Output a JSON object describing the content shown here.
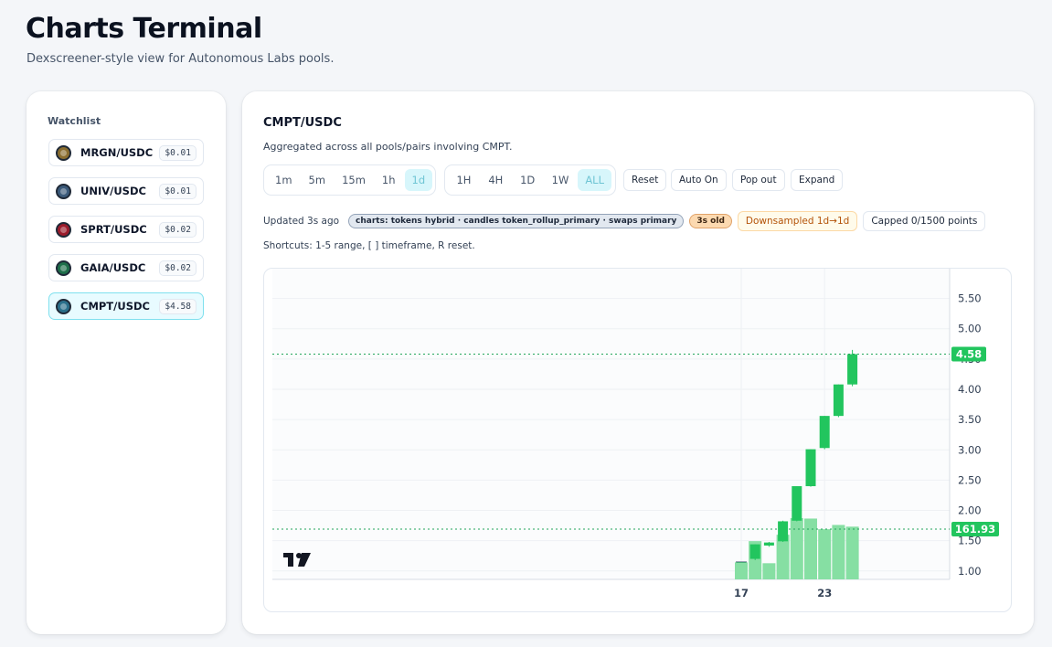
{
  "header": {
    "title": "Charts Terminal",
    "subtitle": "Dexscreener-style view for Autonomous Labs pools."
  },
  "watchlist": {
    "title": "Watchlist",
    "items": [
      {
        "label": "MRGN/USDC",
        "price": "$0.01",
        "color": "#8a6d2f",
        "icon": "mrgn-token-icon"
      },
      {
        "label": "UNIV/USDC",
        "price": "$0.01",
        "color": "#3b5a7a",
        "icon": "univ-token-icon"
      },
      {
        "label": "SPRT/USDC",
        "price": "$0.02",
        "color": "#9b1c2c",
        "icon": "sprt-token-icon"
      },
      {
        "label": "GAIA/USDC",
        "price": "$0.02",
        "color": "#1f6f4a",
        "icon": "gaia-token-icon"
      },
      {
        "label": "CMPT/USDC",
        "price": "$4.58",
        "color": "#2a6f8a",
        "icon": "cmpt-token-icon",
        "active": true
      }
    ]
  },
  "main": {
    "pair_title": "CMPT/USDC",
    "aggregate_text": "Aggregated across all pools/pairs involving CMPT.",
    "timeframes": [
      "1m",
      "5m",
      "15m",
      "1h",
      "1d"
    ],
    "active_timeframe": "1d",
    "ranges": [
      "1H",
      "4H",
      "1D",
      "1W",
      "ALL"
    ],
    "active_range": "ALL",
    "actions": {
      "reset": "Reset",
      "auto": "Auto On",
      "popout": "Pop out",
      "expand": "Expand"
    },
    "status": {
      "updated": "Updated 3s ago",
      "source_badge": "charts: tokens hybrid · candles token_rollup_primary · swaps primary",
      "age_badge": "3s old",
      "downsampled": "Downsampled 1d→1d",
      "capped": "Capped 0/1500 points"
    },
    "shortcuts": "Shortcuts: 1-5 range, [ ] timeframe, R reset."
  },
  "chart_data": {
    "type": "candlestick",
    "y_ticks": [
      "5.50",
      "5.00",
      "4.50",
      "4.00",
      "3.50",
      "3.00",
      "2.50",
      "2.00",
      "1.50",
      "1.00"
    ],
    "ylim": [
      0.65,
      5.75
    ],
    "x_ticks": [
      {
        "label": "17",
        "day": 17
      },
      {
        "label": "23",
        "day": 23
      }
    ],
    "last_price_label": "4.58",
    "volume_label": "161.93",
    "up_color": "#22c55e",
    "volume_color": "#86dfa3",
    "watermark": "tradingview-logo-icon",
    "candles": [
      {
        "day": 17,
        "open": 1.15,
        "high": 1.15,
        "low": 1.15,
        "close": 1.15
      },
      {
        "day": 18,
        "open": 1.2,
        "high": 1.44,
        "low": 1.18,
        "close": 1.44
      },
      {
        "day": 19,
        "open": 1.42,
        "high": 1.48,
        "low": 1.4,
        "close": 1.47
      },
      {
        "day": 20,
        "open": 1.49,
        "high": 1.83,
        "low": 1.48,
        "close": 1.82
      },
      {
        "day": 21,
        "open": 1.83,
        "high": 2.4,
        "low": 1.82,
        "close": 2.4
      },
      {
        "day": 22,
        "open": 2.4,
        "high": 3.01,
        "low": 2.39,
        "close": 3.01
      },
      {
        "day": 23,
        "open": 3.03,
        "high": 3.56,
        "low": 3.01,
        "close": 3.56
      },
      {
        "day": 24,
        "open": 3.56,
        "high": 4.08,
        "low": 3.54,
        "close": 4.08
      },
      {
        "day": 25,
        "open": 4.08,
        "high": 4.65,
        "low": 4.05,
        "close": 4.58
      }
    ],
    "volumes": [
      {
        "day": 17,
        "value": 40
      },
      {
        "day": 18,
        "value": 90
      },
      {
        "day": 19,
        "value": 38
      },
      {
        "day": 20,
        "value": 105
      },
      {
        "day": 21,
        "value": 144
      },
      {
        "day": 22,
        "value": 143
      },
      {
        "day": 23,
        "value": 118
      },
      {
        "day": 24,
        "value": 128
      },
      {
        "day": 25,
        "value": 124
      }
    ]
  }
}
